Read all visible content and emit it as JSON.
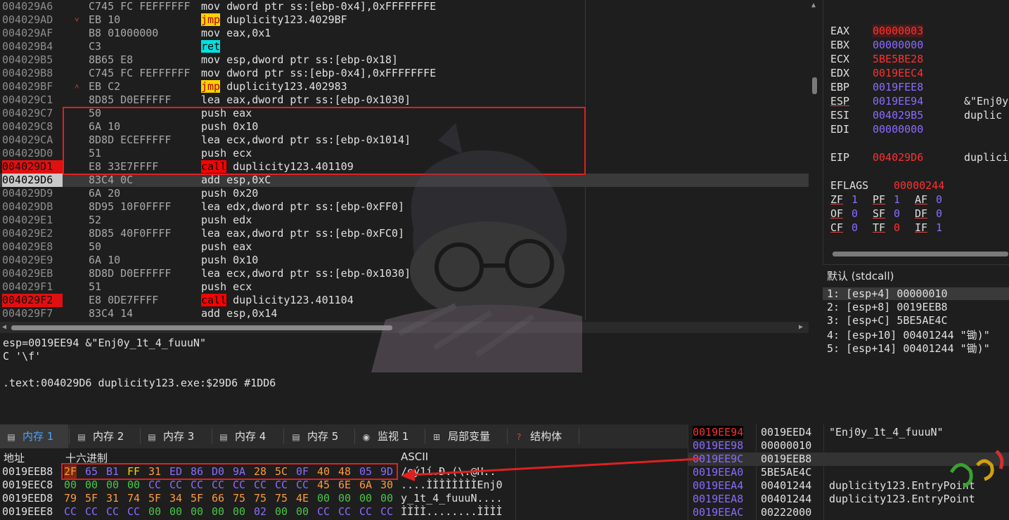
{
  "disasm": {
    "rows": [
      {
        "addr": "004029A6",
        "arrow": "",
        "bytes": "C745 FC FEFFFFFF",
        "mnem": "mov",
        "ops": "dword ptr ss:[ebp-0x4],0xFFFFFFFE",
        "hl": ""
      },
      {
        "addr": "004029AD",
        "arrow": "˅",
        "bytes": "EB 10",
        "mnem": "jmp",
        "ops": "duplicity123.4029BF",
        "hl": "jmp"
      },
      {
        "addr": "004029AF",
        "arrow": "",
        "bytes": "B8 01000000",
        "mnem": "mov",
        "ops": "eax,0x1",
        "hl": ""
      },
      {
        "addr": "004029B4",
        "arrow": "",
        "bytes": "C3",
        "mnem": "ret",
        "ops": "",
        "hl": "ret"
      },
      {
        "addr": "004029B5",
        "arrow": "",
        "bytes": "8B65 E8",
        "mnem": "mov",
        "ops": "esp,dword ptr ss:[ebp-0x18]",
        "hl": ""
      },
      {
        "addr": "004029B8",
        "arrow": "",
        "bytes": "C745 FC FEFFFFFF",
        "mnem": "mov",
        "ops": "dword ptr ss:[ebp-0x4],0xFFFFFFFE",
        "hl": ""
      },
      {
        "addr": "004029BF",
        "arrow": "˄",
        "bytes": "EB C2",
        "mnem": "jmp",
        "ops": "duplicity123.402983",
        "hl": "jmp"
      },
      {
        "addr": "004029C1",
        "arrow": "",
        "bytes": "8D85 D0EFFFFF",
        "mnem": "lea",
        "ops": "eax,dword ptr ss:[ebp-0x1030]",
        "hl": ""
      },
      {
        "addr": "004029C7",
        "arrow": "",
        "bytes": "50",
        "mnem": "push",
        "ops": "eax",
        "hl": ""
      },
      {
        "addr": "004029C8",
        "arrow": "",
        "bytes": "6A 10",
        "mnem": "push",
        "ops": "0x10",
        "hl": ""
      },
      {
        "addr": "004029CA",
        "arrow": "",
        "bytes": "8D8D ECEFFFFF",
        "mnem": "lea",
        "ops": "ecx,dword ptr ss:[ebp-0x1014]",
        "hl": ""
      },
      {
        "addr": "004029D0",
        "arrow": "",
        "bytes": "51",
        "mnem": "push",
        "ops": "ecx",
        "hl": ""
      },
      {
        "addr": "004029D1",
        "arrow": "",
        "bytes": "E8 33E7FFFF",
        "mnem": "call",
        "ops": "duplicity123.401109",
        "hl": "call",
        "bp": true
      },
      {
        "addr": "004029D6",
        "arrow": "",
        "bytes": "83C4 0C",
        "mnem": "add",
        "ops": "esp,0xC",
        "hl": "",
        "cip": true
      },
      {
        "addr": "004029D9",
        "arrow": "",
        "bytes": "6A 20",
        "mnem": "push",
        "ops": "0x20",
        "hl": ""
      },
      {
        "addr": "004029DB",
        "arrow": "",
        "bytes": "8D95 10F0FFFF",
        "mnem": "lea",
        "ops": "edx,dword ptr ss:[ebp-0xFF0]",
        "hl": ""
      },
      {
        "addr": "004029E1",
        "arrow": "",
        "bytes": "52",
        "mnem": "push",
        "ops": "edx",
        "hl": ""
      },
      {
        "addr": "004029E2",
        "arrow": "",
        "bytes": "8D85 40F0FFFF",
        "mnem": "lea",
        "ops": "eax,dword ptr ss:[ebp-0xFC0]",
        "hl": ""
      },
      {
        "addr": "004029E8",
        "arrow": "",
        "bytes": "50",
        "mnem": "push",
        "ops": "eax",
        "hl": ""
      },
      {
        "addr": "004029E9",
        "arrow": "",
        "bytes": "6A 10",
        "mnem": "push",
        "ops": "0x10",
        "hl": ""
      },
      {
        "addr": "004029EB",
        "arrow": "",
        "bytes": "8D8D D0EFFFFF",
        "mnem": "lea",
        "ops": "ecx,dword ptr ss:[ebp-0x1030]",
        "hl": ""
      },
      {
        "addr": "004029F1",
        "arrow": "",
        "bytes": "51",
        "mnem": "push",
        "ops": "ecx",
        "hl": ""
      },
      {
        "addr": "004029F2",
        "arrow": "",
        "bytes": "E8 0DE7FFFF",
        "mnem": "call",
        "ops": "duplicity123.401104",
        "hl": "call",
        "bp": true
      },
      {
        "addr": "004029F7",
        "arrow": "",
        "bytes": "83C4 14",
        "mnem": "add",
        "ops": "esp,0x14",
        "hl": ""
      }
    ]
  },
  "info": {
    "line1": "esp=0019EE94 &\"Enj0y_1t_4_fuuuN\"",
    "line2": "C '\\f'",
    "line3": ".text:004029D6 duplicity123.exe:$29D6 #1DD6"
  },
  "registers": {
    "gp": [
      {
        "name": "EAX",
        "value": "00000003",
        "comment": "",
        "changed": true,
        "selected": true,
        "underline": false
      },
      {
        "name": "EBX",
        "value": "00000000",
        "comment": "",
        "changed": false,
        "underline": false
      },
      {
        "name": "ECX",
        "value": "5BE5BE28",
        "comment": "",
        "changed": true,
        "underline": false
      },
      {
        "name": "EDX",
        "value": "0019EEC4",
        "comment": "",
        "changed": true,
        "underline": false
      },
      {
        "name": "EBP",
        "value": "0019FEE8",
        "comment": "",
        "changed": false,
        "underline": false
      },
      {
        "name": "ESP",
        "value": "0019EE94",
        "comment": "&\"Enj0y",
        "changed": false,
        "underline": true
      },
      {
        "name": "ESI",
        "value": "004029B5",
        "comment": "duplic",
        "changed": false,
        "underline": false
      },
      {
        "name": "EDI",
        "value": "00000000",
        "comment": "",
        "changed": false,
        "underline": false
      }
    ],
    "eip": {
      "name": "EIP",
      "value": "004029D6",
      "comment": "duplici"
    },
    "eflags": {
      "name": "EFLAGS",
      "value": "00000244"
    },
    "flags": [
      [
        {
          "n": "ZF",
          "v": "1",
          "c": false
        },
        {
          "n": "PF",
          "v": "1",
          "c": false
        },
        {
          "n": "AF",
          "v": "0",
          "c": false
        }
      ],
      [
        {
          "n": "OF",
          "v": "0",
          "c": false
        },
        {
          "n": "SF",
          "v": "0",
          "c": false
        },
        {
          "n": "DF",
          "v": "0",
          "c": false
        }
      ],
      [
        {
          "n": "CF",
          "v": "0",
          "c": false
        },
        {
          "n": "TF",
          "v": "0",
          "c": true
        },
        {
          "n": "IF",
          "v": "1",
          "c": false
        }
      ]
    ]
  },
  "call_args": {
    "header": "默认 (stdcall)",
    "items": [
      "1: [esp+4] 00000010",
      "2: [esp+8] 0019EEB8",
      "3: [esp+C] 5BE5AE4C",
      "4: [esp+10] 00401244 \"锄)\"",
      "5: [esp+14] 00401244 \"锄)\""
    ]
  },
  "tabs": [
    {
      "label": "内存 1",
      "icon": "memory-icon",
      "active": true
    },
    {
      "label": "内存 2",
      "icon": "memory-icon",
      "active": false
    },
    {
      "label": "内存 3",
      "icon": "memory-icon",
      "active": false
    },
    {
      "label": "内存 4",
      "icon": "memory-icon",
      "active": false
    },
    {
      "label": "内存 5",
      "icon": "memory-icon",
      "active": false
    },
    {
      "label": "监视 1",
      "icon": "watch-icon",
      "active": false
    },
    {
      "label": "局部变量",
      "icon": "locals-icon",
      "active": false
    },
    {
      "label": "结构体",
      "icon": "struct-icon",
      "active": false
    }
  ],
  "dump": {
    "headers": {
      "addr": "地址",
      "hex": "十六进制",
      "ascii": "ASCII"
    },
    "rows": [
      {
        "addr": "0019EEB8",
        "bytes": [
          [
            "2F",
            "or"
          ],
          [
            "65",
            "pu"
          ],
          [
            "B1",
            "pu"
          ],
          [
            "FF",
            "yl"
          ],
          [
            "31",
            "or"
          ],
          [
            "ED",
            "pu"
          ],
          [
            "86",
            "pu"
          ],
          [
            "D0",
            "pu"
          ],
          [
            "9A",
            "pu"
          ],
          [
            "28",
            "or"
          ],
          [
            "5C",
            "or"
          ],
          [
            "0F",
            "pu"
          ],
          [
            "40",
            "or"
          ],
          [
            "48",
            "or"
          ],
          [
            "05",
            "pu"
          ],
          [
            "9D",
            "pu"
          ]
        ],
        "ascii": "/eý1í.Ð.(\\.@H.."
      },
      {
        "addr": "0019EEC8",
        "bytes": [
          [
            "00",
            "gr"
          ],
          [
            "00",
            "gr"
          ],
          [
            "00",
            "gr"
          ],
          [
            "00",
            "gr"
          ],
          [
            "CC",
            "pu"
          ],
          [
            "CC",
            "pu"
          ],
          [
            "CC",
            "pu"
          ],
          [
            "CC",
            "pu"
          ],
          [
            "CC",
            "pu"
          ],
          [
            "CC",
            "pu"
          ],
          [
            "CC",
            "pu"
          ],
          [
            "CC",
            "pu"
          ],
          [
            "45",
            "or"
          ],
          [
            "6E",
            "or"
          ],
          [
            "6A",
            "or"
          ],
          [
            "30",
            "or"
          ]
        ],
        "ascii": "....ÌÌÌÌÌÌÌÌEnj0"
      },
      {
        "addr": "0019EED8",
        "bytes": [
          [
            "79",
            "or"
          ],
          [
            "5F",
            "or"
          ],
          [
            "31",
            "or"
          ],
          [
            "74",
            "or"
          ],
          [
            "5F",
            "or"
          ],
          [
            "34",
            "or"
          ],
          [
            "5F",
            "or"
          ],
          [
            "66",
            "or"
          ],
          [
            "75",
            "or"
          ],
          [
            "75",
            "or"
          ],
          [
            "75",
            "or"
          ],
          [
            "4E",
            "or"
          ],
          [
            "00",
            "gr"
          ],
          [
            "00",
            "gr"
          ],
          [
            "00",
            "gr"
          ],
          [
            "00",
            "gr"
          ]
        ],
        "ascii": "y_1t_4_fuuuN...."
      },
      {
        "addr": "0019EEE8",
        "bytes": [
          [
            "CC",
            "pu"
          ],
          [
            "CC",
            "pu"
          ],
          [
            "CC",
            "pu"
          ],
          [
            "CC",
            "pu"
          ],
          [
            "00",
            "gr"
          ],
          [
            "00",
            "gr"
          ],
          [
            "00",
            "gr"
          ],
          [
            "00",
            "gr"
          ],
          [
            "00",
            "gr"
          ],
          [
            "02",
            "pu"
          ],
          [
            "00",
            "gr"
          ],
          [
            "00",
            "gr"
          ],
          [
            "CC",
            "pu"
          ],
          [
            "CC",
            "pu"
          ],
          [
            "CC",
            "pu"
          ],
          [
            "CC",
            "pu"
          ]
        ],
        "ascii": "ÌÌÌÌ........ÌÌÌÌ"
      }
    ]
  },
  "stack": {
    "rows": [
      {
        "addr": "0019EE94",
        "value": "0019EED4",
        "comment": "\"Enj0y_1t_4_fuuuN\"",
        "top": true
      },
      {
        "addr": "0019EE98",
        "value": "00000010",
        "comment": ""
      },
      {
        "addr": "0019EE9C",
        "value": "0019EEB8",
        "comment": "",
        "cur": true
      },
      {
        "addr": "0019EEA0",
        "value": "5BE5AE4C",
        "comment": ""
      },
      {
        "addr": "0019EEA4",
        "value": "00401244",
        "comment": "duplicity123.EntryPoint"
      },
      {
        "addr": "0019EEA8",
        "value": "00401244",
        "comment": "duplicity123.EntryPoint"
      },
      {
        "addr": "0019EEAC",
        "value": "00222000",
        "comment": ""
      }
    ]
  },
  "colors": {
    "accent": "#4aa3ff",
    "breakpoint": "#e01010",
    "annotation": "#e02020"
  }
}
